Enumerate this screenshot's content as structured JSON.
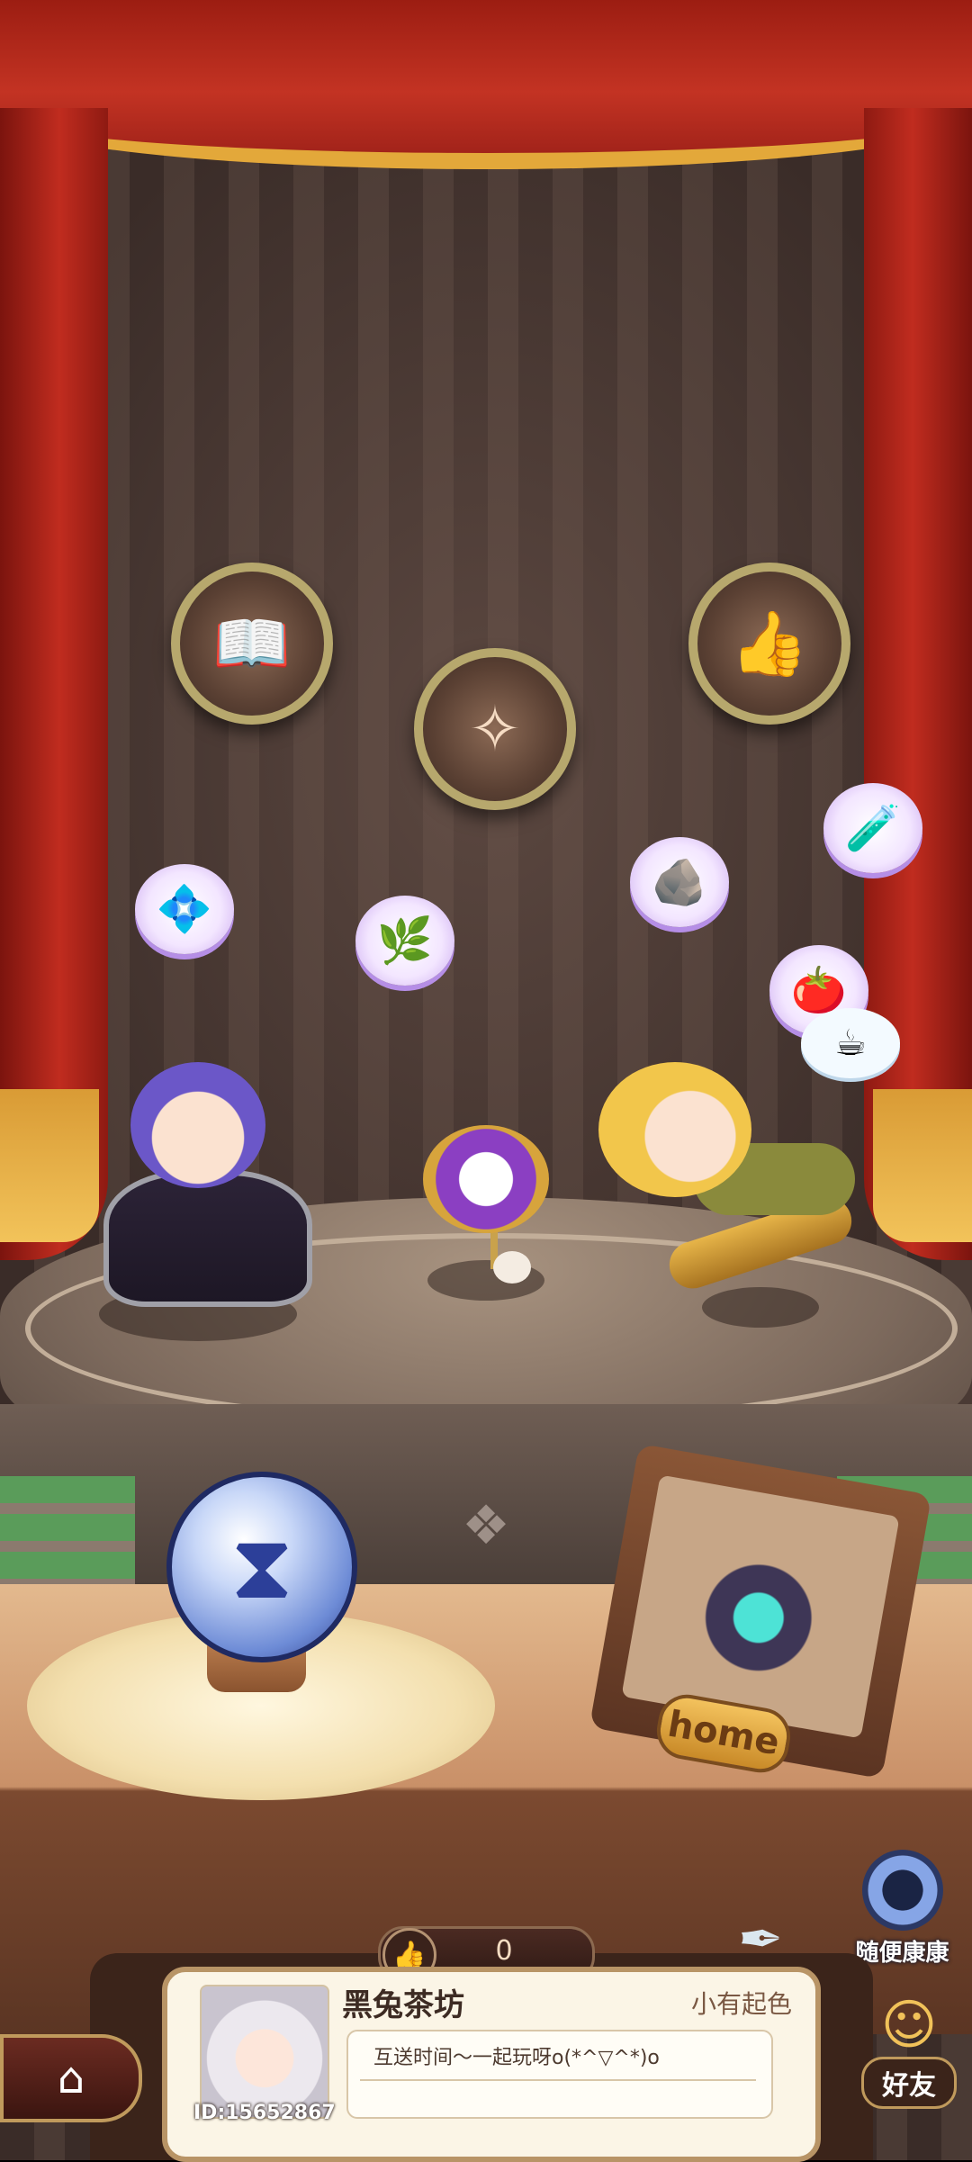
{
  "scene": {
    "medals": [
      {
        "name": "book-medal-icon",
        "glyph": "📖"
      },
      {
        "name": "fairy-medal-icon",
        "glyph": "✧"
      },
      {
        "name": "thumbs-up-medal-icon",
        "glyph": "👍"
      }
    ],
    "bubbles": [
      {
        "name": "mirror-item-bubble",
        "glyph": "💠"
      },
      {
        "name": "herb-item-bubble",
        "glyph": "🌿"
      },
      {
        "name": "ore-item-bubble",
        "glyph": "🪨"
      },
      {
        "name": "potion-item-bubble",
        "glyph": "🧪"
      },
      {
        "name": "tomato-item-bubble",
        "glyph": "🍅"
      }
    ],
    "thought_glyph": "☕",
    "ornament_glyph": "❖",
    "hourglass_glyph": "⧗",
    "quill_glyph": "✒"
  },
  "home_sign": "home",
  "random_visit": {
    "label": "随便康康"
  },
  "likes": {
    "count": "0",
    "icon": "👍"
  },
  "player": {
    "name": "黑兔茶坊",
    "status": "小有起色",
    "id": "ID:15652867",
    "message": "互送时间～一起玩呀o(*^▽^*)o"
  },
  "nav": {
    "home_icon": "⌂",
    "friends_icon": "☺",
    "friends_label": "好友"
  }
}
